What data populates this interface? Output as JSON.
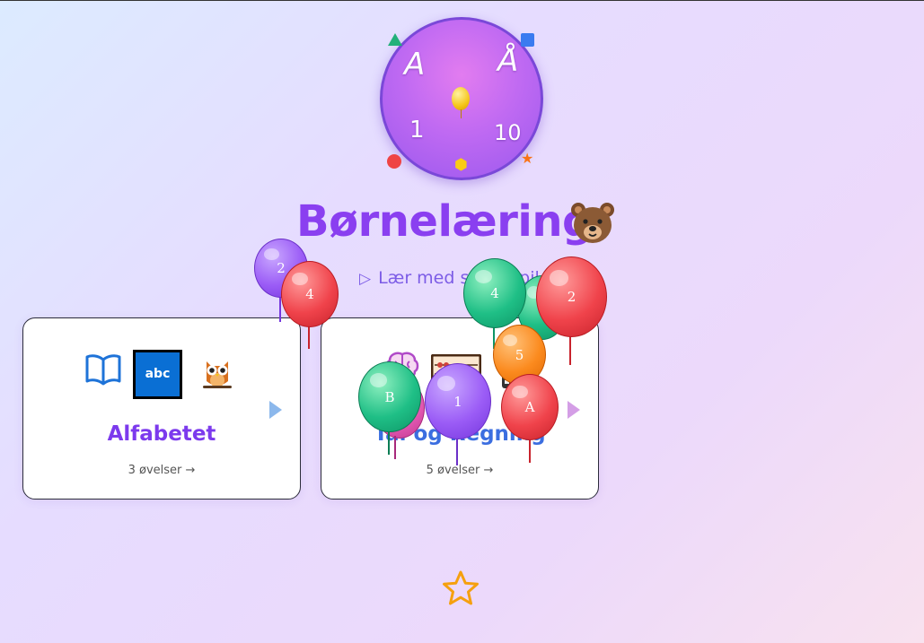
{
  "app": {
    "title": "Børnelæring",
    "title_emoji": "bear-face",
    "subtitle": "Lær med sjove spil"
  },
  "logo": {
    "chars": [
      "A",
      "Å",
      "1",
      "10"
    ]
  },
  "cards": [
    {
      "name": "Alfabetet",
      "count": "3 øvelser →",
      "icons": [
        "open-book-icon",
        "abc-input-icon",
        "owl-icon"
      ],
      "accent": "#7c3aed"
    },
    {
      "name": "Tal og Regning",
      "count": "5 øvelser →",
      "icons": [
        "brain-icon",
        "abacus-icon",
        "calculator-icon"
      ],
      "accent": "#3b6ee0"
    }
  ],
  "balloons": [
    {
      "label": "2",
      "color": "purple"
    },
    {
      "label": "4",
      "color": "red"
    },
    {
      "label": "4",
      "color": "green"
    },
    {
      "label": "",
      "color": "green"
    },
    {
      "label": "2",
      "color": "red"
    },
    {
      "label": "5",
      "color": "orange"
    },
    {
      "label": "B",
      "color": "green"
    },
    {
      "label": "",
      "color": "pink"
    },
    {
      "label": "1",
      "color": "purple"
    },
    {
      "label": "A",
      "color": "red"
    }
  ],
  "colors": {
    "primary": "#8a3ff0",
    "star": "#f5a00f"
  }
}
